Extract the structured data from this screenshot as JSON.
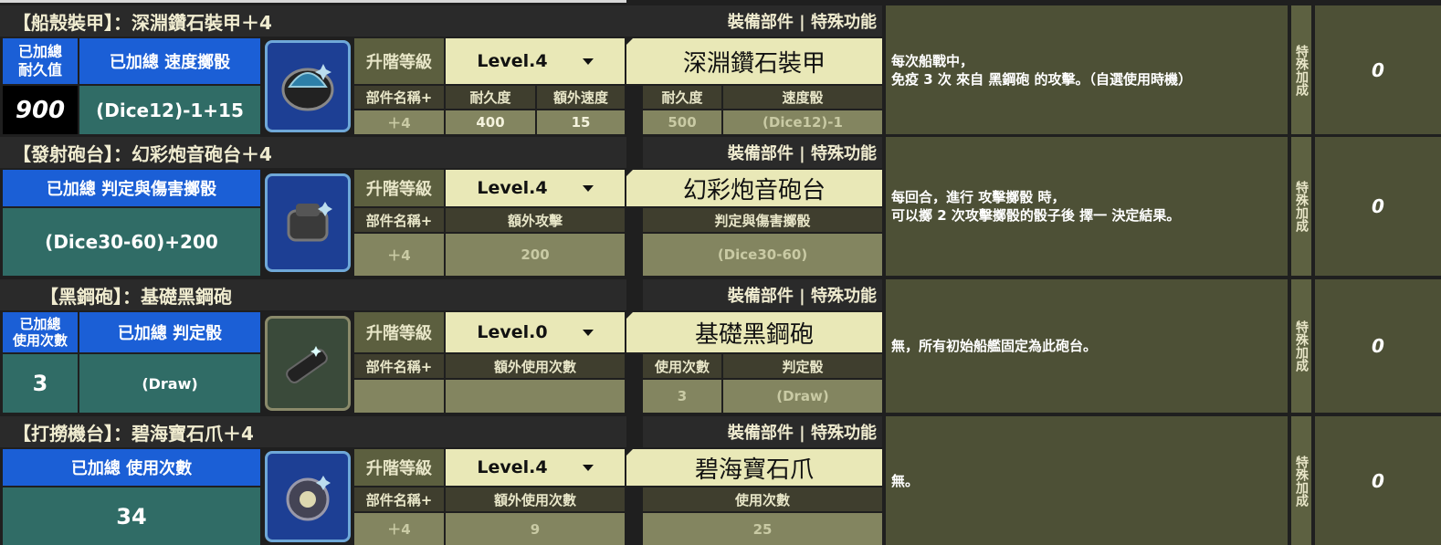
{
  "common": {
    "equip_section_label": "裝備部件 | 特殊功能",
    "upgrade_level_label": "升階等級",
    "part_name_plus_label": "部件名稱+",
    "special_bonus_label": "特殊加成",
    "dropdown_icon": "caret-down-icon"
  },
  "rows": [
    {
      "header_title": "【船殼裝甲】：深淵鑽石裝甲＋4",
      "total_label_a": "已加總\n耐久值",
      "total_label_b": "已加總  速度擲骰",
      "total_value_a": "900",
      "total_value_b": "(Dice12)-1+15",
      "level": "Level.4",
      "part_name": "深淵鑽石裝甲",
      "col_extra1_label": "耐久度",
      "col_extra2_label": "額外速度",
      "col_base1_label": "耐久度",
      "col_base2_label": "速度骰",
      "plus_value": "＋4",
      "extra1_value": "400",
      "extra2_value": "15",
      "base1_value": "500",
      "base2_value": "(Dice12)-1",
      "desc_line1": "每次船戰中，",
      "desc_line2": "免疫 3 次 來自 黑鋼砲 的攻擊。（自選使用時機）",
      "special_value": "0",
      "icon": "diamond-armor-icon"
    },
    {
      "header_title": "【發射砲台】：幻彩炮音砲台＋4",
      "total_label": "已加總  判定與傷害擲骰",
      "total_value": "(Dice30-60)+200",
      "level": "Level.4",
      "part_name": "幻彩炮音砲台",
      "col_extra_label": "額外攻擊",
      "col_base_label": "判定與傷害擲骰",
      "plus_value": "＋4",
      "extra_value": "200",
      "base_value": "(Dice30-60)",
      "desc_line1": "每回合，進行 攻擊擲骰 時，",
      "desc_line2": "可以擲 2 次攻擊擲骰的骰子後 擇一 決定結果。",
      "special_value": "0",
      "icon": "cannon-turret-icon"
    },
    {
      "header_title": "【黑鋼砲】：基礎黑鋼砲",
      "total_label_a": "已加總\n使用次數",
      "total_label_b": "已加總  判定骰",
      "total_value_a": "3",
      "total_value_b": "(Draw)",
      "level": "Level.0",
      "part_name": "基礎黑鋼砲",
      "col_extra_label": "額外使用次數",
      "col_base1_label": "使用次數",
      "col_base2_label": "判定骰",
      "plus_value": "",
      "extra_value": "",
      "base1_value": "3",
      "base2_value": "(Draw)",
      "desc_line1": "無，所有初始船艦固定為此砲台。",
      "special_value": "0",
      "icon": "black-steel-cannon-icon"
    },
    {
      "header_title": "【打撈機台】：碧海寶石爪＋4",
      "total_label": "已加總  使用次數",
      "total_value": "34",
      "level": "Level.4",
      "part_name": "碧海寶石爪",
      "col_extra_label": "額外使用次數",
      "col_base_label": "使用次數",
      "plus_value": "＋4",
      "extra_value": "9",
      "base_value": "25",
      "desc_line1": "無。",
      "special_value": "0",
      "icon": "gem-claw-icon"
    }
  ]
}
